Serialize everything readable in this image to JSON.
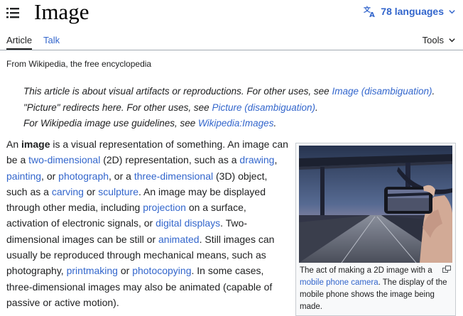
{
  "header": {
    "title": "Image",
    "languages_label": "78 languages"
  },
  "tabs": {
    "article": "Article",
    "talk": "Talk",
    "tools": "Tools"
  },
  "tagline": "From Wikipedia, the free encyclopedia",
  "hatnotes": {
    "line1_prefix": "This article is about visual artifacts or reproductions. For other uses, see ",
    "line1_link": "Image (disambiguation)",
    "line1_suffix": ".",
    "line2_prefix": "\"Picture\" redirects here. For other uses, see ",
    "line2_link": "Picture (disambiguation)",
    "line2_suffix": ".",
    "line3_prefix": "For Wikipedia image use guidelines, see ",
    "line3_link": "Wikipedia:Images",
    "line3_suffix": "."
  },
  "body": {
    "t1": "An ",
    "bold_image": "image",
    "t2": " is a visual representation of something. An image can be a ",
    "l_2d": "two-dimensional",
    "t3": " (2D) representation, such as a ",
    "l_drawing": "drawing",
    "t4": ", ",
    "l_painting": "painting",
    "t5": ", or ",
    "l_photograph": "photograph",
    "t6": ", or a ",
    "l_3d": "three-dimensional",
    "t7": " (3D) object, such as a ",
    "l_carving": "carving",
    "t8": " or ",
    "l_sculpture": "sculpture",
    "t9": ". An image may be displayed through other media, including ",
    "l_projection": "projection",
    "t10": " on a surface, activation of electronic signals, or ",
    "l_digital": "digital displays",
    "t11": ". Two-dimensional images can be still or ",
    "l_animated": "animated",
    "t12": ". Still images can usually be reproduced through mechanical means, such as photography, ",
    "l_printmaking": "printmaking",
    "t13": " or ",
    "l_photocopying": "photocopying",
    "t14": ". In some cases, three-dimensional images may also be animated (capable of passive or active motion)."
  },
  "figure": {
    "cap1": "The act of making a 2D image with a ",
    "cap_link": "mobile phone camera",
    "cap2": ". The display of the mobile phone shows the image being made."
  },
  "colors": {
    "link": "#3366cc",
    "text": "#202122"
  },
  "icons": {
    "menu": "hamburger-icon",
    "language": "translate-icon",
    "dropdown": "chevron-down-icon",
    "enlarge": "magnify-icon"
  }
}
